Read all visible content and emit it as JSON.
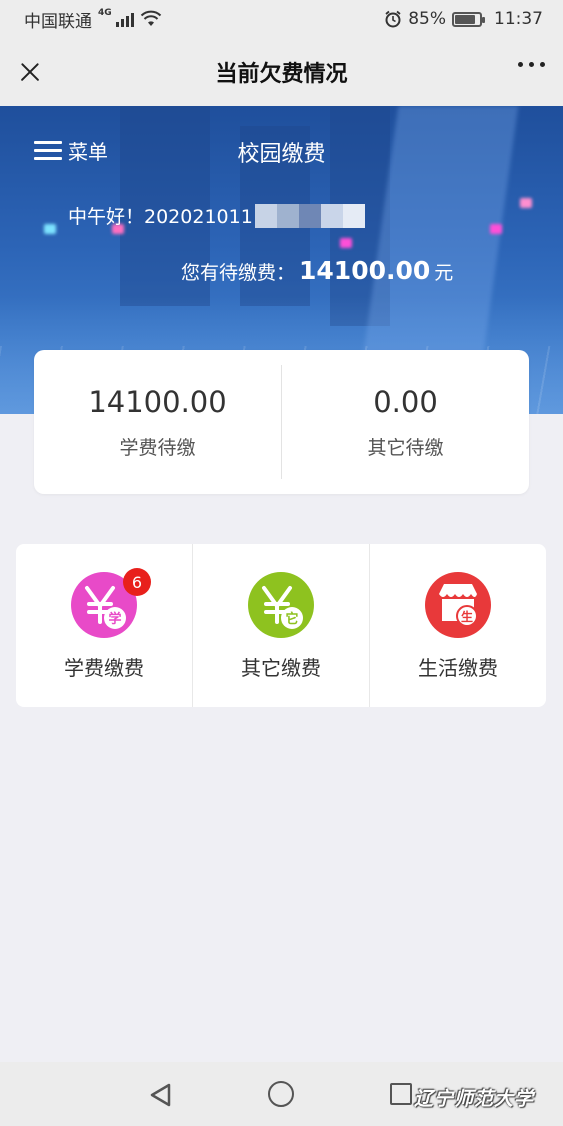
{
  "status_bar": {
    "carrier": "中国联通",
    "network": "4G",
    "battery": "85%",
    "battery_level": 0.85,
    "time": "11:37"
  },
  "navbar": {
    "title": "当前欠费情况"
  },
  "hero": {
    "menu_label": "菜单",
    "title": "校园缴费",
    "greeting": "中午好！202021011",
    "pending_label": "您有待缴费：",
    "pending_amount": "14100.00",
    "pending_unit": "元"
  },
  "summary": {
    "tuition_value": "14100.00",
    "tuition_label": "学费待缴",
    "other_value": "0.00",
    "other_label": "其它待缴"
  },
  "payments": [
    {
      "label": "学费缴费",
      "icon": "tuition-yuan-icon",
      "badge": "6",
      "color": "#e84ac8",
      "glyph": "学"
    },
    {
      "label": "其它缴费",
      "icon": "other-yuan-icon",
      "badge": "",
      "color": "#8ec21f",
      "glyph": "它"
    },
    {
      "label": "生活缴费",
      "icon": "shop-life-icon",
      "badge": "",
      "color": "#e8393a",
      "glyph": "生"
    }
  ],
  "watermark": "辽宁师范大学",
  "colors": {
    "hero_blue": "#2c64b6",
    "badge_red": "#e8201c",
    "tuition_pink": "#e84ac8",
    "other_green": "#8ec21f",
    "life_red": "#e8393a"
  }
}
